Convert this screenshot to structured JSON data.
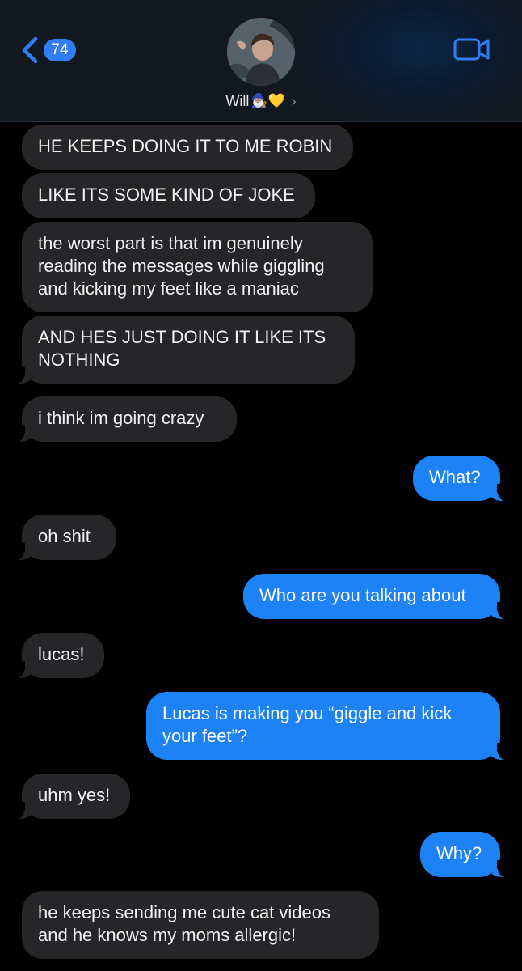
{
  "header": {
    "back_badge": "74",
    "contact_name": "Will",
    "contact_emoji": "🧙🏽‍♂️💛",
    "name_chevron": "›",
    "accent_color": "#2f7ef5"
  },
  "messages": [
    {
      "from": "them",
      "lines": [
        "HE KEEPS DOING IT TO ME ROBIN"
      ]
    },
    {
      "from": "them",
      "lines": [
        "LIKE ITS SOME KIND OF JOKE"
      ]
    },
    {
      "from": "them",
      "lines": [
        "the worst part is that im genuinely",
        "reading the messages while giggling",
        "and kicking my feet like a maniac"
      ]
    },
    {
      "from": "them",
      "lines": [
        "AND HES JUST DOING IT LIKE ITS",
        "NOTHING"
      ]
    },
    {
      "from": "them",
      "lines": [
        "i think im going crazy"
      ]
    },
    {
      "from": "me",
      "lines": [
        "What?"
      ]
    },
    {
      "from": "them",
      "lines": [
        "oh shit"
      ]
    },
    {
      "from": "me",
      "lines": [
        "Who are you talking about"
      ]
    },
    {
      "from": "them",
      "lines": [
        "lucas!"
      ]
    },
    {
      "from": "me",
      "lines": [
        "Lucas is making you “giggle and kick",
        "your feet”?"
      ]
    },
    {
      "from": "them",
      "lines": [
        "uhm yes!"
      ]
    },
    {
      "from": "me",
      "lines": [
        "Why?"
      ]
    },
    {
      "from": "them",
      "lines": [
        "he keeps sending me cute cat videos",
        "and he knows my moms allergic!"
      ]
    }
  ]
}
